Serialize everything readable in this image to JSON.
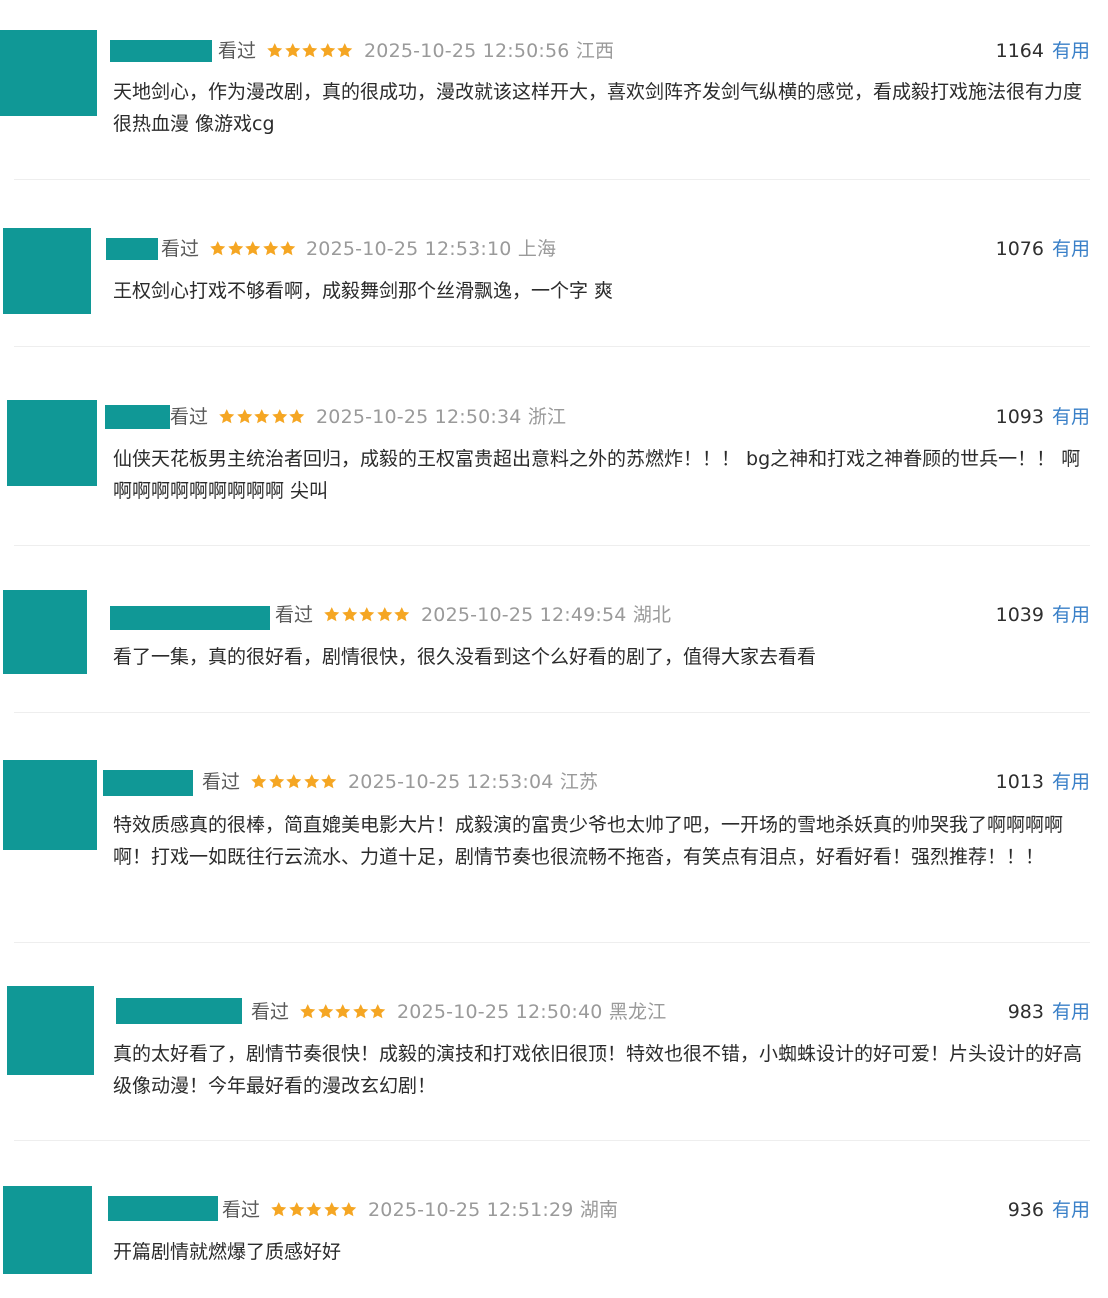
{
  "star_color": "#f5a623",
  "comments": [
    {
      "status": "看过",
      "rating": 5,
      "datetime": "2025-10-25 12:50:56",
      "region": "江西",
      "votes": "1164",
      "useful": "有用",
      "text": "天地剑心，作为漫改剧，真的很成功，漫改就该这样开大，喜欢剑阵齐发剑气纵横的感觉，看成毅打戏施法很有力度 很热血漫 像游戏cg"
    },
    {
      "status": "看过",
      "rating": 5,
      "datetime": "2025-10-25 12:53:10",
      "region": "上海",
      "votes": "1076",
      "useful": "有用",
      "text": "王权剑心打戏不够看啊，成毅舞剑那个丝滑飘逸，一个字 爽"
    },
    {
      "status": "看过",
      "rating": 5,
      "datetime": "2025-10-25 12:50:34",
      "region": "浙江",
      "votes": "1093",
      "useful": "有用",
      "text": "仙侠天花板男主统治者回归，成毅的王权富贵超出意料之外的苏燃炸！！！ bg之神和打戏之神眷顾的世兵一！！ 啊啊啊啊啊啊啊啊啊啊 尖叫"
    },
    {
      "status": "看过",
      "rating": 5,
      "datetime": "2025-10-25 12:49:54",
      "region": "湖北",
      "votes": "1039",
      "useful": "有用",
      "text": "看了一集，真的很好看，剧情很快，很久没看到这个么好看的剧了，值得大家去看看"
    },
    {
      "status": "看过",
      "rating": 5,
      "datetime": "2025-10-25 12:53:04",
      "region": "江苏",
      "votes": "1013",
      "useful": "有用",
      "text": "特效质感真的很棒，简直媲美电影大片！成毅演的富贵少爷也太帅了吧，一开场的雪地杀妖真的帅哭我了啊啊啊啊啊！打戏一如既往行云流水、力道十足，剧情节奏也很流畅不拖沓，有笑点有泪点，好看好看！强烈推荐！！！"
    },
    {
      "status": "看过",
      "rating": 5,
      "datetime": "2025-10-25 12:50:40",
      "region": "黑龙江",
      "votes": "983",
      "useful": "有用",
      "text": "真的太好看了，剧情节奏很快！成毅的演技和打戏依旧很顶！特效也很不错，小蜘蛛设计的好可爱！片头设计的好高级像动漫！今年最好看的漫改玄幻剧！"
    },
    {
      "status": "看过",
      "rating": 5,
      "datetime": "2025-10-25 12:51:29",
      "region": "湖南",
      "votes": "936",
      "useful": "有用",
      "text": "开篇剧情就燃爆了质感好好"
    }
  ]
}
